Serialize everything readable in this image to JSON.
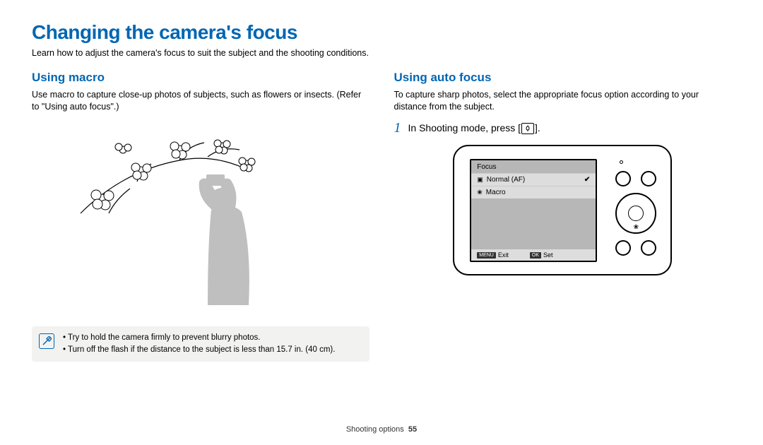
{
  "title": "Changing the camera's focus",
  "intro": "Learn how to adjust the camera's focus to suit the subject and the shooting conditions.",
  "left": {
    "heading": "Using macro",
    "body": "Use macro to capture close-up photos of subjects, such as flowers or insects. (Refer to \"Using auto focus\".)"
  },
  "notes": {
    "item1": "Try to hold the camera firmly to prevent blurry photos.",
    "item2": "Turn off the flash if the distance to the subject is less than 15.7 in. (40 cm)."
  },
  "right": {
    "heading": "Using auto focus",
    "body": "To capture sharp photos, select the appropriate focus option according to your distance from the subject.",
    "step1_pre": "In Shooting mode, press [",
    "step1_post": "]."
  },
  "screen": {
    "title": "Focus",
    "row1": "Normal (AF)",
    "row2": "Macro",
    "footer_left": "Exit",
    "footer_right": "Set",
    "badge_menu": "MENU",
    "badge_ok": "OK"
  },
  "footer": {
    "section": "Shooting options",
    "page": "55"
  }
}
